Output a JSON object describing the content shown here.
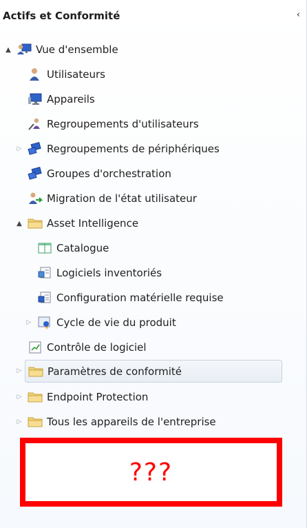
{
  "header": {
    "title": "Actifs et Conformité",
    "collapse_glyph": "‹"
  },
  "tree": [
    {
      "label": "Vue d'ensemble",
      "expander": "▲",
      "icon": "users-monitor-icon"
    },
    {
      "label": "Utilisateurs",
      "icon": "user-icon"
    },
    {
      "label": "Appareils",
      "icon": "monitor-icon"
    },
    {
      "label": "Regroupements d'utilisateurs",
      "icon": "user-collection-icon"
    },
    {
      "label": "Regroupements de périphériques",
      "expander": "▷",
      "icon": "device-collection-icon"
    },
    {
      "label": "Groupes d'orchestration",
      "icon": "orchestration-icon"
    },
    {
      "label": "Migration de l'état utilisateur",
      "icon": "migration-icon"
    },
    {
      "label": "Asset Intelligence",
      "expander": "▲",
      "icon": "folder-icon"
    },
    {
      "label": "Catalogue",
      "icon": "catalog-icon"
    },
    {
      "label": "Logiciels inventoriés",
      "icon": "software-icon"
    },
    {
      "label": "Configuration matérielle requise",
      "icon": "hardware-icon"
    },
    {
      "label": "Cycle de vie du produit",
      "expander": "▷",
      "icon": "lifecycle-icon"
    },
    {
      "label": "Contrôle de logiciel",
      "icon": "metering-icon"
    },
    {
      "label": "Paramètres de conformité",
      "expander": "▷",
      "icon": "folder-icon",
      "selected": true
    },
    {
      "label": "Endpoint Protection",
      "expander": "▷",
      "icon": "folder-icon"
    },
    {
      "label": "Tous les appareils de l'entreprise",
      "expander": "▷",
      "icon": "folder-icon"
    }
  ],
  "annotation": {
    "text": "???"
  }
}
